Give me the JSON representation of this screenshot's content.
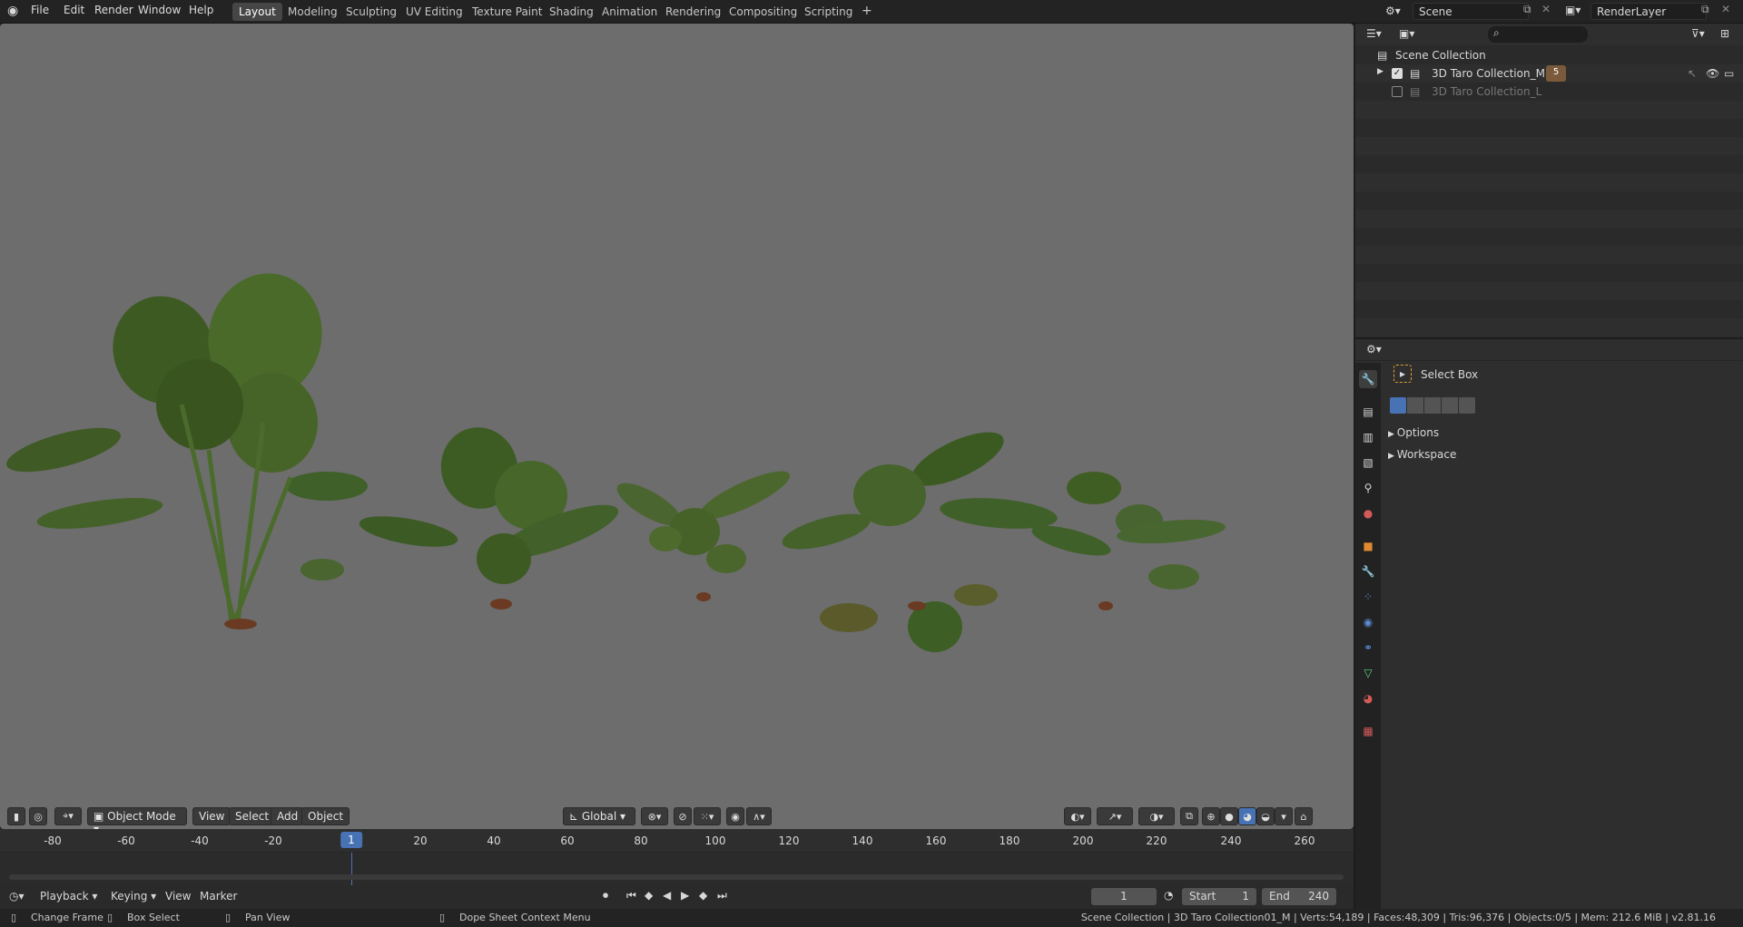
{
  "topbar": {
    "menus": [
      "File",
      "Edit",
      "Render",
      "Window",
      "Help"
    ],
    "workspaces": [
      "Layout",
      "Modeling",
      "Sculpting",
      "UV Editing",
      "Texture Paint",
      "Shading",
      "Animation",
      "Rendering",
      "Compositing",
      "Scripting"
    ],
    "add_tab": "+",
    "scene": "Scene",
    "render_layer": "RenderLayer"
  },
  "viewport": {
    "mode": "Object Mode",
    "menus": [
      "View",
      "Select",
      "Add",
      "Object"
    ],
    "orientation": "Global",
    "background": "#6d6d6d"
  },
  "timeline": {
    "ticks": [
      "-80",
      "-60",
      "-40",
      "-20",
      "1",
      "20",
      "40",
      "60",
      "80",
      "100",
      "120",
      "140",
      "160",
      "180",
      "200",
      "220",
      "240",
      "260"
    ],
    "menus": [
      "Playback",
      "Keying",
      "View",
      "Marker"
    ],
    "current_frame": "1",
    "start_label": "Start",
    "start": "1",
    "end_label": "End",
    "end": "240"
  },
  "outliner": {
    "root": "Scene Collection",
    "items": [
      {
        "label": "3D Taro Collection_M",
        "enabled": true
      },
      {
        "label": "3D Taro Collection_L",
        "enabled": false
      }
    ],
    "badge_count": "5"
  },
  "properties": {
    "tool": "Select Box",
    "panels": [
      "Options",
      "Workspace"
    ]
  },
  "statusbar": {
    "hints": [
      "Change Frame",
      "Box Select",
      "Pan View",
      "Dope Sheet Context Menu"
    ],
    "info": "Scene Collection | 3D Taro Collection01_M | Verts:54,189 | Faces:48,309 | Tris:96,376 | Objects:0/5 | Mem: 212.6 MiB | v2.81.16"
  },
  "colors": {
    "accent": "#4772b3",
    "active_tab": "#464646"
  }
}
